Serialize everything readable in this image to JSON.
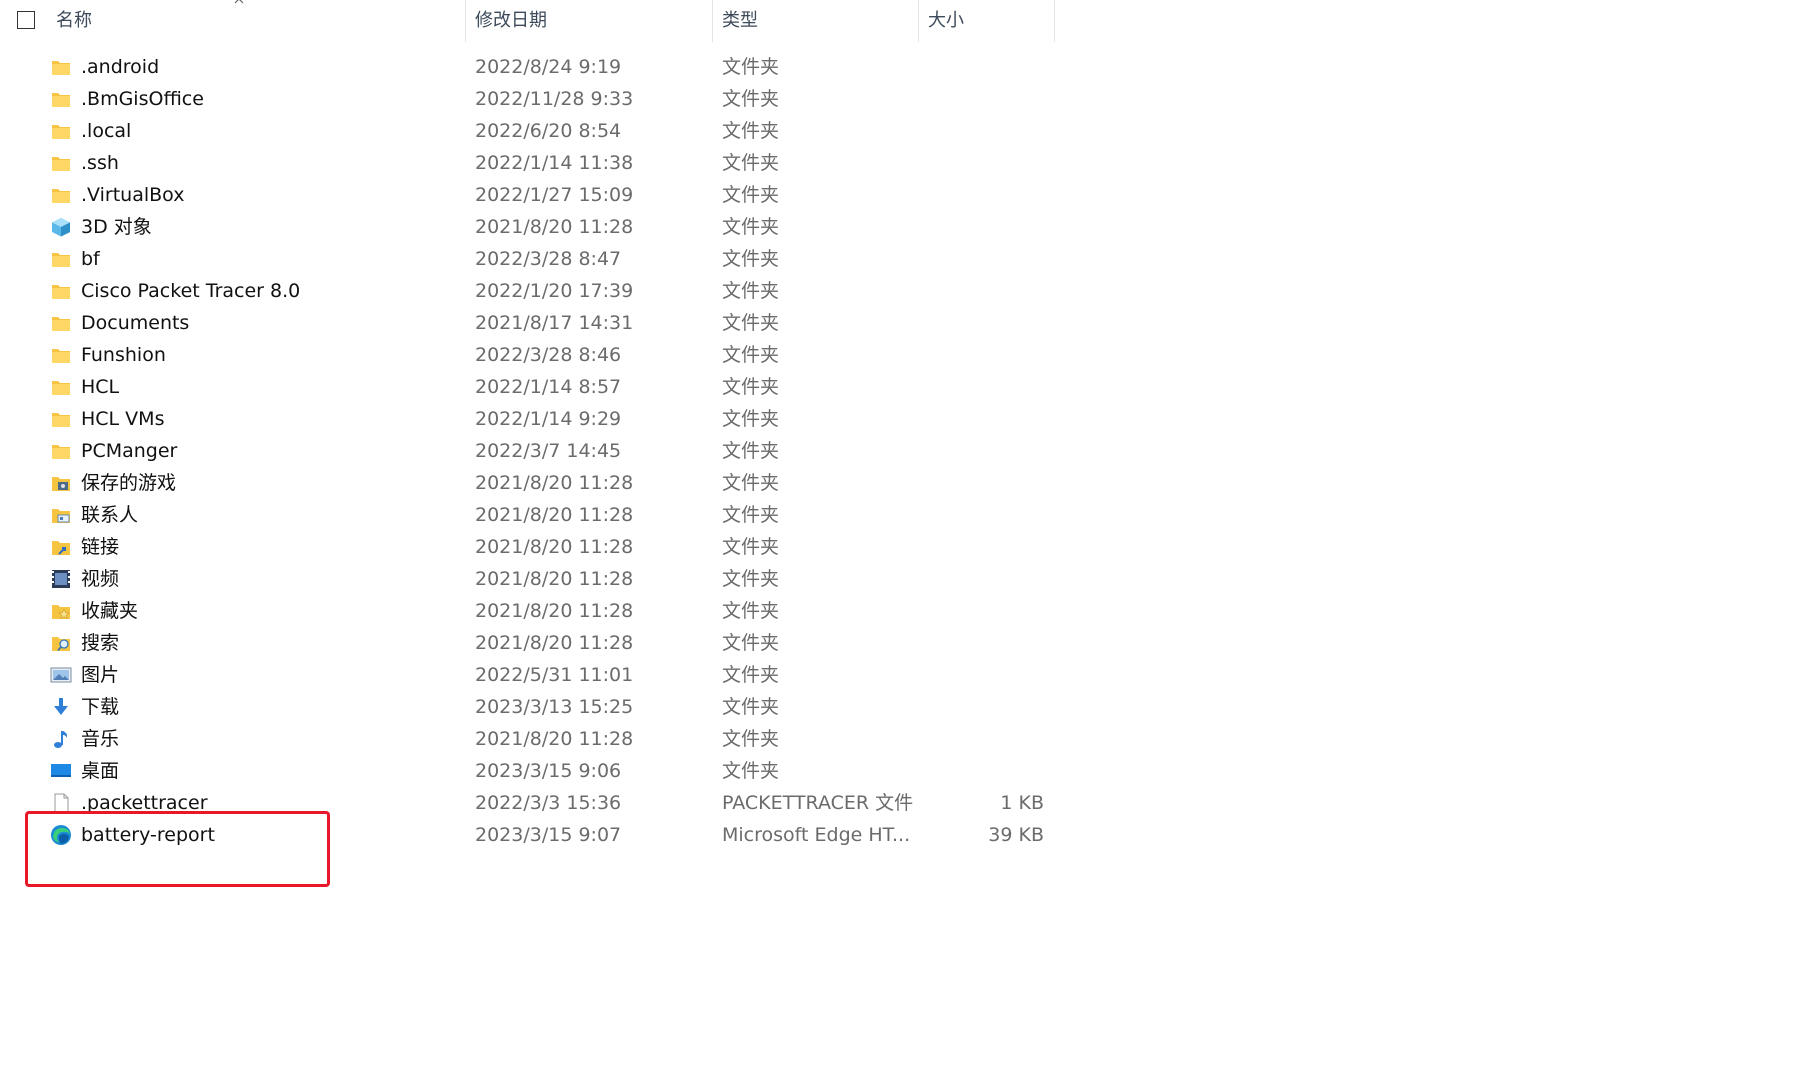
{
  "header": {
    "name_label": "名称",
    "date_label": "修改日期",
    "type_label": "类型",
    "size_label": "大小"
  },
  "files": [
    {
      "name": ".android",
      "date": "2022/8/24 9:19",
      "type": "文件夹",
      "size": "",
      "icon": "folder-icon"
    },
    {
      "name": ".BmGisOffice",
      "date": "2022/11/28 9:33",
      "type": "文件夹",
      "size": "",
      "icon": "folder-icon"
    },
    {
      "name": ".local",
      "date": "2022/6/20 8:54",
      "type": "文件夹",
      "size": "",
      "icon": "folder-icon"
    },
    {
      "name": ".ssh",
      "date": "2022/1/14 11:38",
      "type": "文件夹",
      "size": "",
      "icon": "folder-icon"
    },
    {
      "name": ".VirtualBox",
      "date": "2022/1/27 15:09",
      "type": "文件夹",
      "size": "",
      "icon": "folder-icon"
    },
    {
      "name": "3D 对象",
      "date": "2021/8/20 11:28",
      "type": "文件夹",
      "size": "",
      "icon": "3d-objects-icon"
    },
    {
      "name": "bf",
      "date": "2022/3/28 8:47",
      "type": "文件夹",
      "size": "",
      "icon": "folder-icon"
    },
    {
      "name": "Cisco Packet Tracer 8.0",
      "date": "2022/1/20 17:39",
      "type": "文件夹",
      "size": "",
      "icon": "folder-icon"
    },
    {
      "name": "Documents",
      "date": "2021/8/17 14:31",
      "type": "文件夹",
      "size": "",
      "icon": "folder-icon"
    },
    {
      "name": "Funshion",
      "date": "2022/3/28 8:46",
      "type": "文件夹",
      "size": "",
      "icon": "folder-icon"
    },
    {
      "name": "HCL",
      "date": "2022/1/14 8:57",
      "type": "文件夹",
      "size": "",
      "icon": "folder-icon"
    },
    {
      "name": "HCL VMs",
      "date": "2022/1/14 9:29",
      "type": "文件夹",
      "size": "",
      "icon": "folder-icon"
    },
    {
      "name": "PCManger",
      "date": "2022/3/7 14:45",
      "type": "文件夹",
      "size": "",
      "icon": "folder-icon"
    },
    {
      "name": "保存的游戏",
      "date": "2021/8/20 11:28",
      "type": "文件夹",
      "size": "",
      "icon": "saved-games-icon"
    },
    {
      "name": "联系人",
      "date": "2021/8/20 11:28",
      "type": "文件夹",
      "size": "",
      "icon": "contacts-icon"
    },
    {
      "name": "链接",
      "date": "2021/8/20 11:28",
      "type": "文件夹",
      "size": "",
      "icon": "links-icon"
    },
    {
      "name": "视频",
      "date": "2021/8/20 11:28",
      "type": "文件夹",
      "size": "",
      "icon": "videos-icon"
    },
    {
      "name": "收藏夹",
      "date": "2021/8/20 11:28",
      "type": "文件夹",
      "size": "",
      "icon": "favorites-icon"
    },
    {
      "name": "搜索",
      "date": "2021/8/20 11:28",
      "type": "文件夹",
      "size": "",
      "icon": "searches-icon"
    },
    {
      "name": "图片",
      "date": "2022/5/31 11:01",
      "type": "文件夹",
      "size": "",
      "icon": "pictures-icon"
    },
    {
      "name": "下载",
      "date": "2023/3/13 15:25",
      "type": "文件夹",
      "size": "",
      "icon": "downloads-icon"
    },
    {
      "name": "音乐",
      "date": "2021/8/20 11:28",
      "type": "文件夹",
      "size": "",
      "icon": "music-icon"
    },
    {
      "name": "桌面",
      "date": "2023/3/15 9:06",
      "type": "文件夹",
      "size": "",
      "icon": "desktop-icon"
    },
    {
      "name": ".packettracer",
      "date": "2022/3/3 15:36",
      "type": "PACKETTRACER 文件",
      "size": "1 KB",
      "icon": "file-icon"
    },
    {
      "name": "battery-report",
      "date": "2023/3/15 9:07",
      "type": "Microsoft Edge HT...",
      "size": "39 KB",
      "icon": "edge-icon"
    }
  ],
  "colors": {
    "highlight": "#e8182a",
    "folder": "#f5c542"
  }
}
